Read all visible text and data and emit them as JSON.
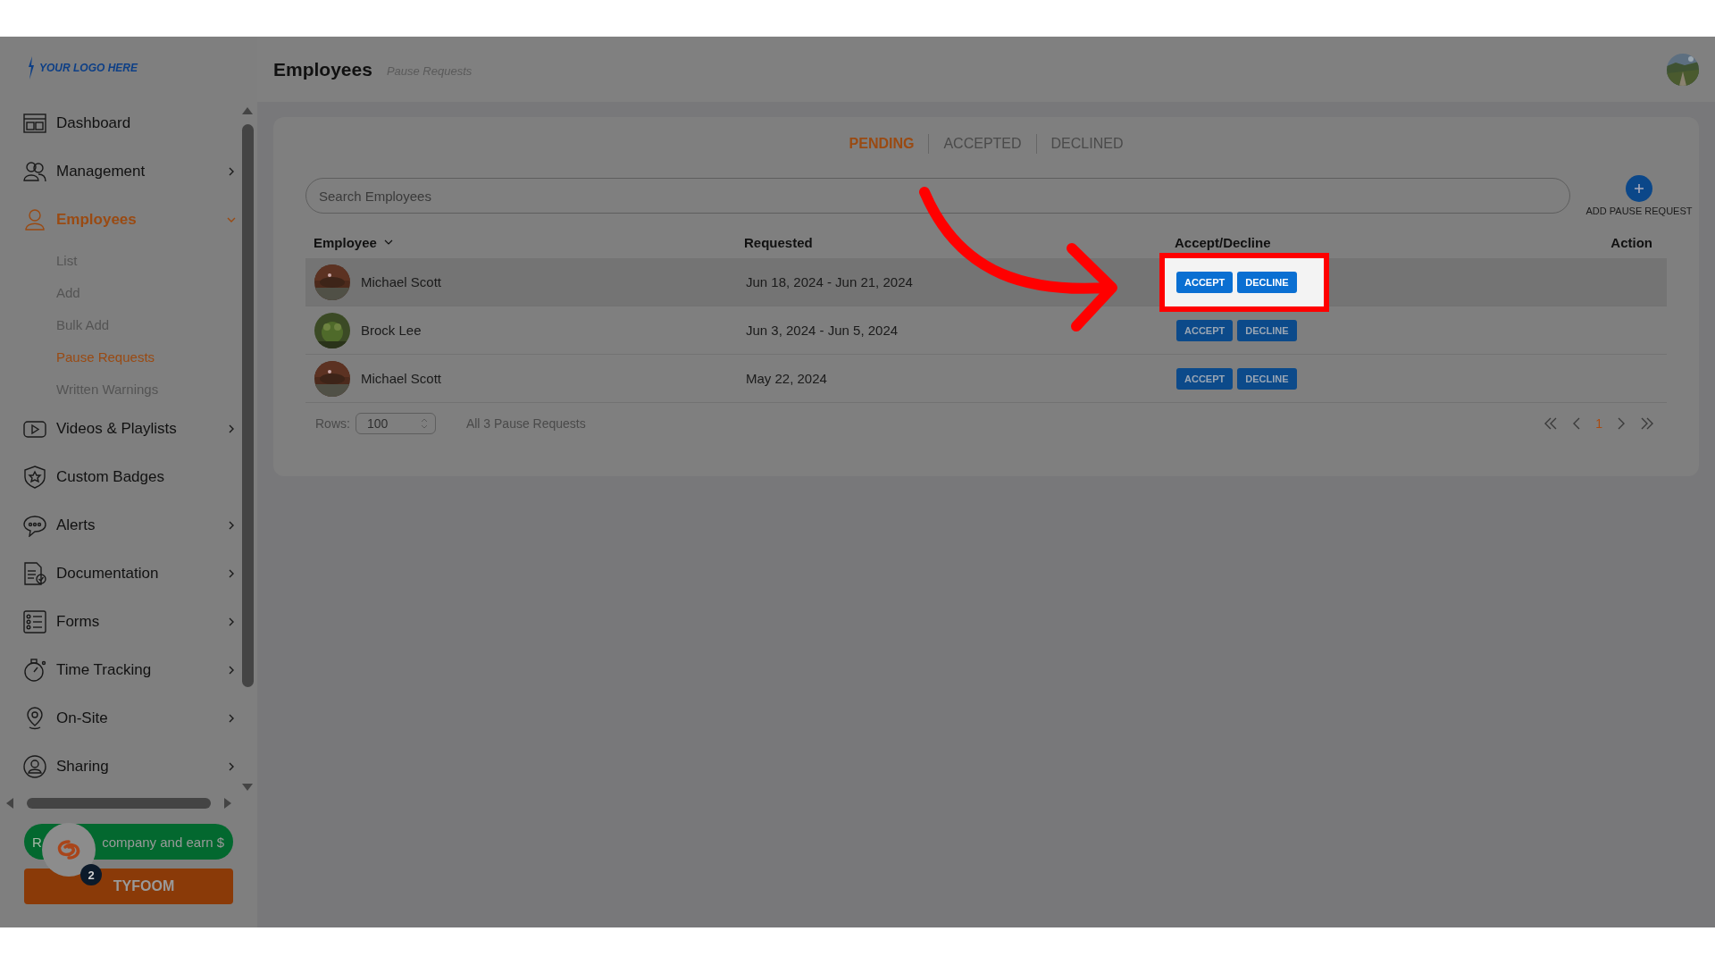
{
  "sidebar": {
    "logo": "YOUR LOGO HERE",
    "items": [
      {
        "label": "Dashboard",
        "selected": false
      },
      {
        "label": "Management",
        "expanded": false,
        "selected": false
      },
      {
        "label": "Employees",
        "expanded": true,
        "selected": true,
        "children": [
          {
            "label": "List",
            "selected": false
          },
          {
            "label": "Add",
            "selected": false
          },
          {
            "label": "Bulk Add",
            "selected": false
          },
          {
            "label": "Pause Requests",
            "selected": true
          },
          {
            "label": "Written Warnings",
            "selected": false
          }
        ]
      },
      {
        "label": "Videos & Playlists",
        "expanded": false,
        "selected": false
      },
      {
        "label": "Custom Badges",
        "selected": false
      },
      {
        "label": "Alerts",
        "expanded": false,
        "selected": false
      },
      {
        "label": "Documentation",
        "expanded": false,
        "selected": false
      },
      {
        "label": "Forms",
        "expanded": false,
        "selected": false
      },
      {
        "label": "Time Tracking",
        "expanded": false,
        "selected": false
      },
      {
        "label": "On-Site",
        "expanded": false,
        "selected": false
      },
      {
        "label": "Sharing",
        "expanded": false,
        "selected": false
      }
    ],
    "refer_button": {
      "label_start": "R",
      "label_end": "company and earn $"
    },
    "brand_button": {
      "label": "TYFOOM"
    },
    "chat_badge": "2"
  },
  "header": {
    "title": "Employees",
    "subtitle": "Pause Requests"
  },
  "tabs": [
    {
      "label": "PENDING",
      "selected": true
    },
    {
      "label": "ACCEPTED",
      "selected": false
    },
    {
      "label": "DECLINED",
      "selected": false
    }
  ],
  "search": {
    "placeholder": "Search Employees"
  },
  "add_button": {
    "label": "ADD PAUSE REQUEST"
  },
  "table": {
    "columns": [
      "Employee",
      "Requested",
      "Accept/Decline",
      "Action"
    ],
    "rows": [
      {
        "employee": "Michael Scott",
        "requested": "Jun 18, 2024 - Jun 21, 2024",
        "accept": "ACCEPT",
        "decline": "DECLINE",
        "selected": true,
        "highlighted": true
      },
      {
        "employee": "Brock Lee",
        "requested": "Jun 3, 2024 - Jun 5, 2024",
        "accept": "ACCEPT",
        "decline": "DECLINE",
        "selected": false,
        "highlighted": false
      },
      {
        "employee": "Michael Scott",
        "requested": "May 22, 2024",
        "accept": "ACCEPT",
        "decline": "DECLINE",
        "selected": false,
        "highlighted": false
      }
    ]
  },
  "footer": {
    "rows_label": "Rows:",
    "rows_value": "100",
    "summary": "All 3 Pause Requests",
    "pages": [
      {
        "label": "1",
        "selected": true
      }
    ]
  }
}
